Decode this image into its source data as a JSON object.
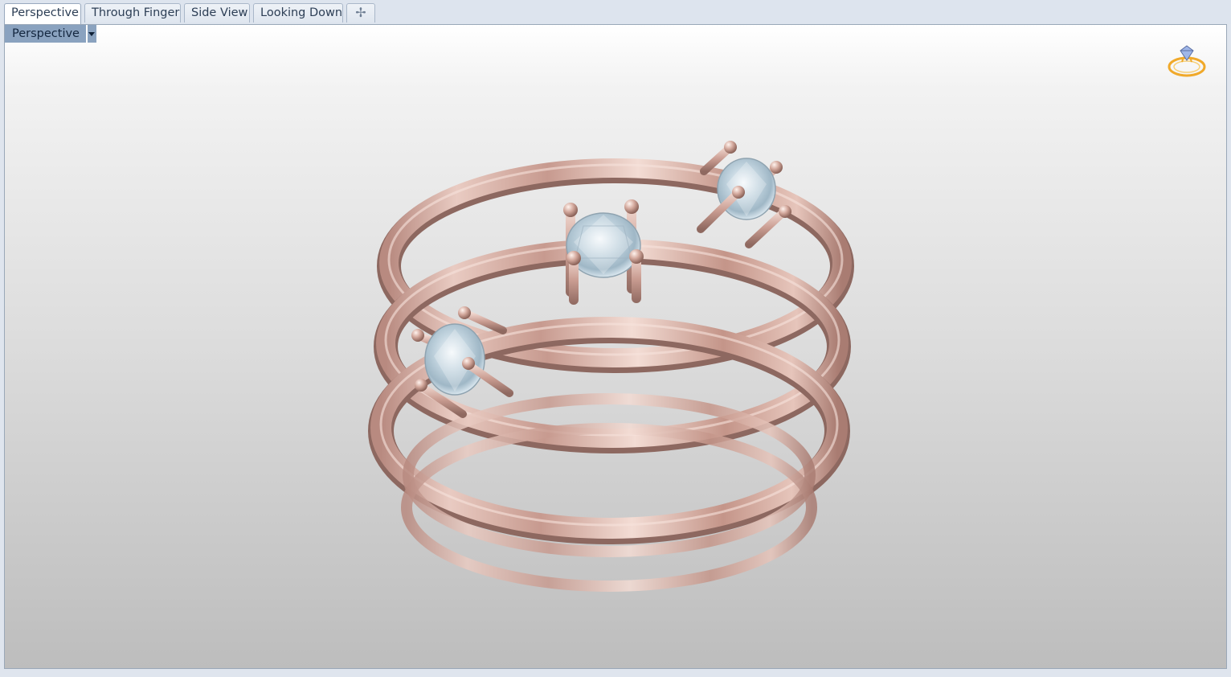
{
  "tabs": [
    {
      "label": "Perspective",
      "active": true
    },
    {
      "label": "Through Finger",
      "active": false
    },
    {
      "label": "Side View",
      "active": false
    },
    {
      "label": "Looking Down",
      "active": false
    }
  ],
  "add_tab_icon": "plus-icon",
  "viewport": {
    "label": "Perspective",
    "dropdown_icon": "dropdown-arrow-icon",
    "corner_icon": "ring-diamond-icon"
  },
  "colors": {
    "metal": "#d9b2a7",
    "gem": "#c7d8e3",
    "label_bg": "#8aa2bf",
    "icon_gold": "#f0a92a"
  }
}
